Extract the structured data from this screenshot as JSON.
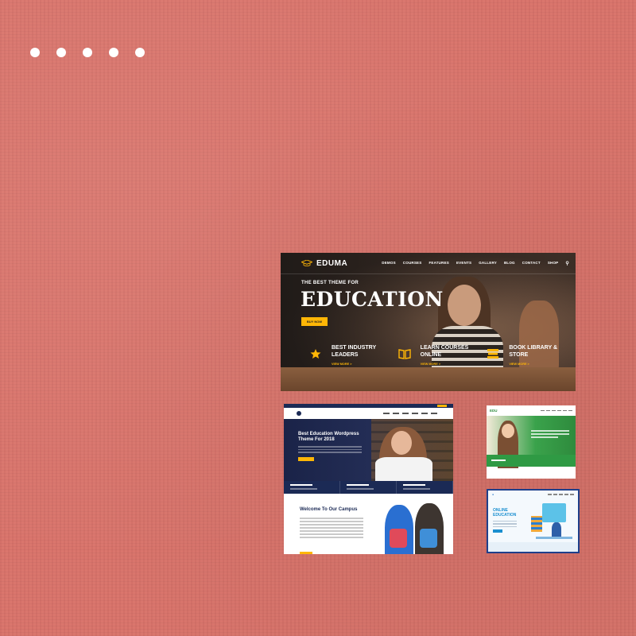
{
  "eduma": {
    "logo_text": "EDUMA",
    "menu": [
      "DEMOS",
      "COURSES",
      "FEATURES",
      "EVENTS",
      "GALLERY",
      "BLOG",
      "CONTACT",
      "SHOP"
    ],
    "eyebrow": "THE BEST THEME FOR",
    "headline": "EDUCATION",
    "cta_label": "BUY NOW",
    "features": [
      {
        "icon": "star-award-icon",
        "title_line1": "BEST INDUSTRY",
        "title_line2": "LEADERS",
        "link": "VIEW MORE >"
      },
      {
        "icon": "open-book-icon",
        "title_line1": "LEARN COURSES",
        "title_line2": "ONLINE",
        "link": "VIEW MORE >"
      },
      {
        "icon": "book-stack-icon",
        "title_line1": "BOOK LIBRARY &",
        "title_line2": "STORE",
        "link": "VIEW MORE >"
      }
    ]
  },
  "shot2": {
    "hero_title": "Best Education Wordpress Theme For 2018",
    "welcome": "Welcome To Our Campus"
  },
  "shot3": {
    "logo_text": "EDU"
  },
  "shot4": {
    "title_line1": "ONLINE",
    "title_line2": "EDUCATION"
  },
  "colors": {
    "background": "#d9736a",
    "accent_yellow": "#ffb606",
    "navy": "#1b2a55",
    "green": "#2f9a44",
    "blue": "#1a8fd0"
  }
}
